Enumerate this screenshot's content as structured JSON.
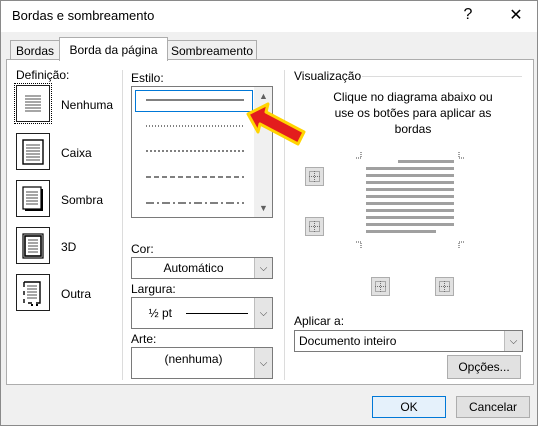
{
  "window": {
    "title": "Bordas e sombreamento",
    "help": "?",
    "close": "✕"
  },
  "tabs": [
    {
      "label": "Bordas",
      "active": false
    },
    {
      "label": "Borda da página",
      "active": true
    },
    {
      "label": "Sombreamento",
      "active": false
    }
  ],
  "definicao": {
    "label": "Definição:",
    "items": [
      {
        "label": "Nenhuma",
        "icon": "none-icon",
        "selected": true
      },
      {
        "label": "Caixa",
        "icon": "box-icon",
        "selected": false
      },
      {
        "label": "Sombra",
        "icon": "shadow-icon",
        "selected": false
      },
      {
        "label": "3D",
        "icon": "3d-icon",
        "selected": false
      },
      {
        "label": "Outra",
        "icon": "custom-icon",
        "selected": false
      }
    ]
  },
  "estilo": {
    "label": "Estilo:",
    "styles": [
      "solid",
      "dotted",
      "small-dash",
      "dash",
      "dash-dot"
    ],
    "selected_index": 0
  },
  "cor": {
    "label": "Cor:",
    "value": "Automático"
  },
  "largura": {
    "label": "Largura:",
    "value": "½ pt"
  },
  "arte": {
    "label": "Arte:",
    "value": "(nenhuma)"
  },
  "visualizacao": {
    "label": "Visualização",
    "hint": "Clique no diagrama abaixo ou use os botões para aplicar as bordas"
  },
  "aplicar": {
    "label": "Aplicar a:",
    "value": "Documento inteiro"
  },
  "buttons": {
    "opcoes": "Opções...",
    "ok": "OK",
    "cancelar": "Cancelar"
  },
  "colors": {
    "accent": "#0078d7",
    "arrow_fill": "#e31d1d",
    "arrow_outline": "#ffd400"
  }
}
